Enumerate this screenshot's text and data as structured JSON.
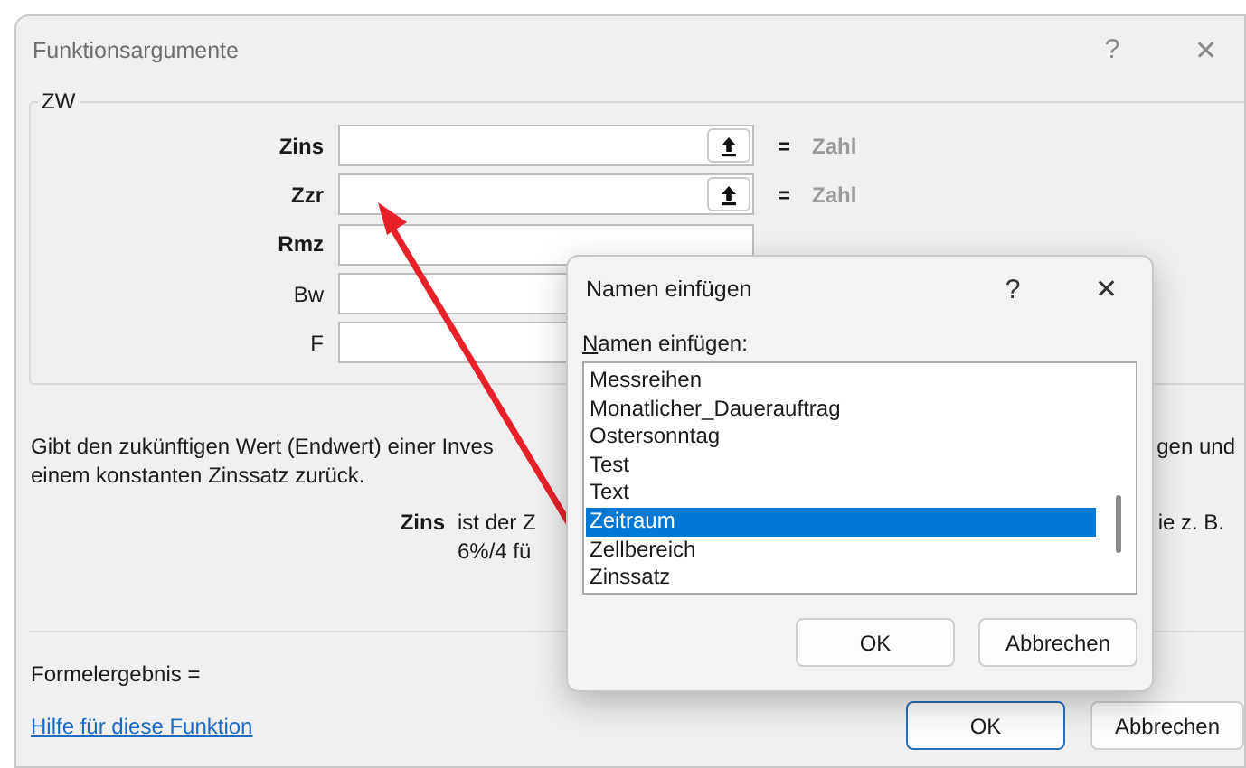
{
  "window": {
    "title": "Funktionsargumente",
    "title_buttons": [
      "?",
      "✕"
    ]
  },
  "function_group": {
    "name": "ZW",
    "arguments": [
      {
        "label": "Zins",
        "bold": true,
        "equals": "=",
        "result": "Zahl"
      },
      {
        "label": "Zzr",
        "bold": true,
        "equals": "=",
        "result": "Zahl"
      },
      {
        "label": "Rmz",
        "bold": true
      },
      {
        "label": "Bw",
        "bold": false
      },
      {
        "label": "F",
        "bold": false
      }
    ]
  },
  "description": {
    "line_1_left": "Gibt den zukünftigen Wert (Endwert) einer Inves",
    "line_1_right": "gen und",
    "line_2": "einem konstanten Zinssatz zurück."
  },
  "argument_help": {
    "name": "Zins",
    "line_1_left": "ist der Z",
    "line_1_right": "ie z. B.",
    "line_2": "6%/4 fü"
  },
  "formula_result": {
    "label": "Formelergebnis ="
  },
  "help_link": "Hilfe für diese Funktion",
  "buttons": [
    {
      "label": "OK",
      "focused": true
    },
    {
      "label": "Abbrechen",
      "focused": false
    }
  ],
  "popup": {
    "title": "Namen einfügen",
    "title_buttons": [
      "?",
      "✕"
    ],
    "label": "Namen einfügen:",
    "items": [
      {
        "label": "Messreihen",
        "selected": false
      },
      {
        "label": "Monatlicher_Dauerauftrag",
        "selected": false
      },
      {
        "label": "Ostersonntag",
        "selected": false
      },
      {
        "label": "Test",
        "selected": false
      },
      {
        "label": "Text",
        "selected": false
      },
      {
        "label": "Zeitraum",
        "selected": true
      },
      {
        "label": "Zellbereich",
        "selected": false
      },
      {
        "label": "Zinssatz",
        "selected": false
      }
    ],
    "buttons": [
      {
        "label": "OK"
      },
      {
        "label": "Abbrechen"
      }
    ]
  }
}
